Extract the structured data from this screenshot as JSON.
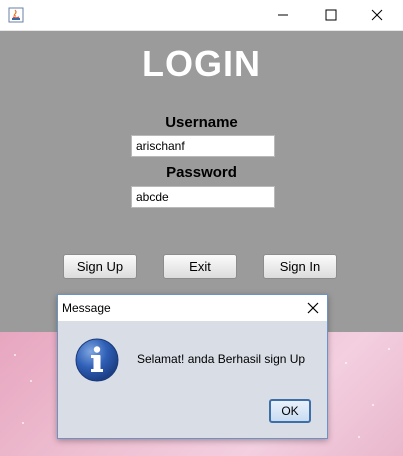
{
  "window": {
    "icons": {
      "app": "java-icon",
      "minimize": "minimize-icon",
      "maximize": "maximize-icon",
      "close": "close-icon"
    }
  },
  "login": {
    "title": "LOGIN",
    "username_label": "Username",
    "username_value": "arischanf",
    "password_label": "Password",
    "password_value": "abcde",
    "buttons": {
      "signup": "Sign Up",
      "exit": "Exit",
      "signin": "Sign In"
    },
    "colors": {
      "panel": "#9b9b9b",
      "title": "#ffffff"
    }
  },
  "dialog": {
    "title": "Message",
    "message": "Selamat! anda Berhasil sign Up",
    "ok_label": "OK",
    "icon": "info-icon"
  }
}
